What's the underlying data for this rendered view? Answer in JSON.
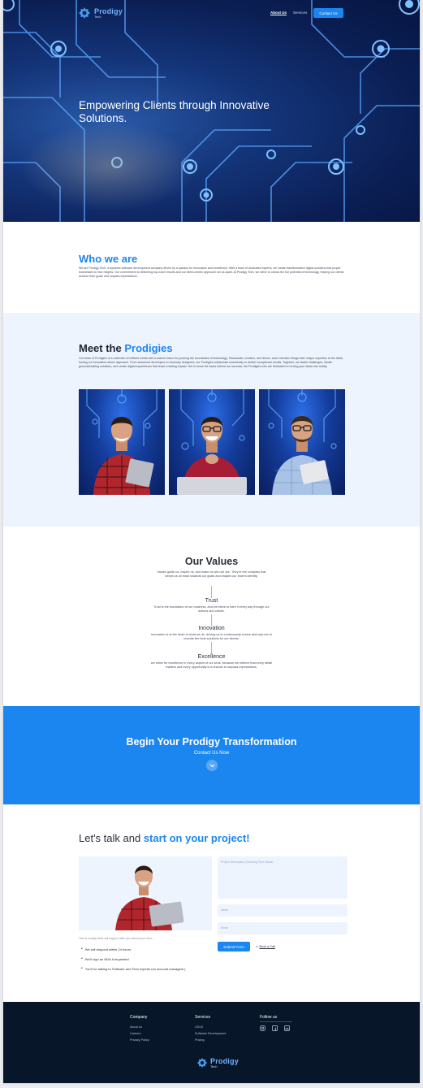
{
  "nav": {
    "logo_name": "Prodigy",
    "logo_sub": "Tech",
    "about": "About Us",
    "services": "Services",
    "contact": "Contact Us"
  },
  "hero": {
    "title": "Empowering Clients through Innovative Solutions."
  },
  "who": {
    "title": "Who we are",
    "text": "We are Prodigy Tech, a dynamic software development company driven by a passion for innovation and excellence. With a team of dedicated experts, we create transformative digital solutions that propel businesses to new heights. Our commitment to delivering top-notch results and our client-centric approach set us apart. At Prodigy Tech, we strive to unlock the full potential of technology, helping our clients achieve their goals and surpass expectations."
  },
  "prodigies": {
    "title_plain": "Meet the",
    "title_accent": "Prodigies",
    "text": "Our team of Prodigies is a collection of brilliant minds with a shared vision for pushing the boundaries of technology. Passionate, creative, and driven, each member brings their unique expertise to the table, fueling our innovation-driven approach. From seasoned developers to visionary designers, our Prodigies collaborate seamlessly to deliver exceptional results. Together, we tackle challenges, ideate groundbreaking solutions, and create digital experiences that leave a lasting impact. Get to know the faces behind our success, the Prodigies who are dedicated to turning your ideas into reality."
  },
  "values": {
    "title": "Our Values",
    "intro": "Values guide us, inspire us, and make us who we are. They're the compass that keeps us on track towards our goals and shapes our team's identity.",
    "items": [
      {
        "title": "Trust",
        "text": "Trust is the foundation of our business, and we strive to earn it every day through our actions and values."
      },
      {
        "title": "Innovation",
        "text": "Innovation is at the heart of what we do, driving us to continuously evolve and improve to provide the best solutions for our clients."
      },
      {
        "title": "Excellence",
        "text": "we strive for excellence in every aspect of our work, because we believe that every detail matters and every opportunity is a chance to surpass expectations."
      }
    ]
  },
  "cta": {
    "title": "Begin Your Prodigy Transformation",
    "sub": "Contact Us Now"
  },
  "project": {
    "title_plain": "Let's talk and",
    "title_accent": "start on your project!",
    "expect": "This is exactly what will happen after you submit your form.",
    "bullets": [
      "We will respond within 24 hours.",
      "We'll sign an NDA if requested",
      "You'll be talking to Software and Tech experts (no account managers.)"
    ],
    "desc_placeholder": "Project Description (Including Tech Stack)",
    "name_placeholder": "Name",
    "email_placeholder": "Email",
    "submit": "Submit Form",
    "or": "or",
    "book": "Book a Call"
  },
  "footer": {
    "company": {
      "title": "Company",
      "links": [
        "About us",
        "Careers",
        "Privacy Policy"
      ]
    },
    "services": {
      "title": "Services",
      "links": [
        "UX/UI",
        "Software Development",
        "Pricing"
      ]
    },
    "follow": {
      "title": "Follow us"
    },
    "logo_name": "Prodigy",
    "logo_sub": "Tech"
  },
  "colors": {
    "accent": "#1b86ef",
    "footer_bg": "#071628",
    "section_tint": "#eef4fd"
  },
  "icons": [
    "logo-gear-icon",
    "chevron-down-icon",
    "instagram-icon",
    "facebook-icon",
    "linkedin-icon"
  ]
}
